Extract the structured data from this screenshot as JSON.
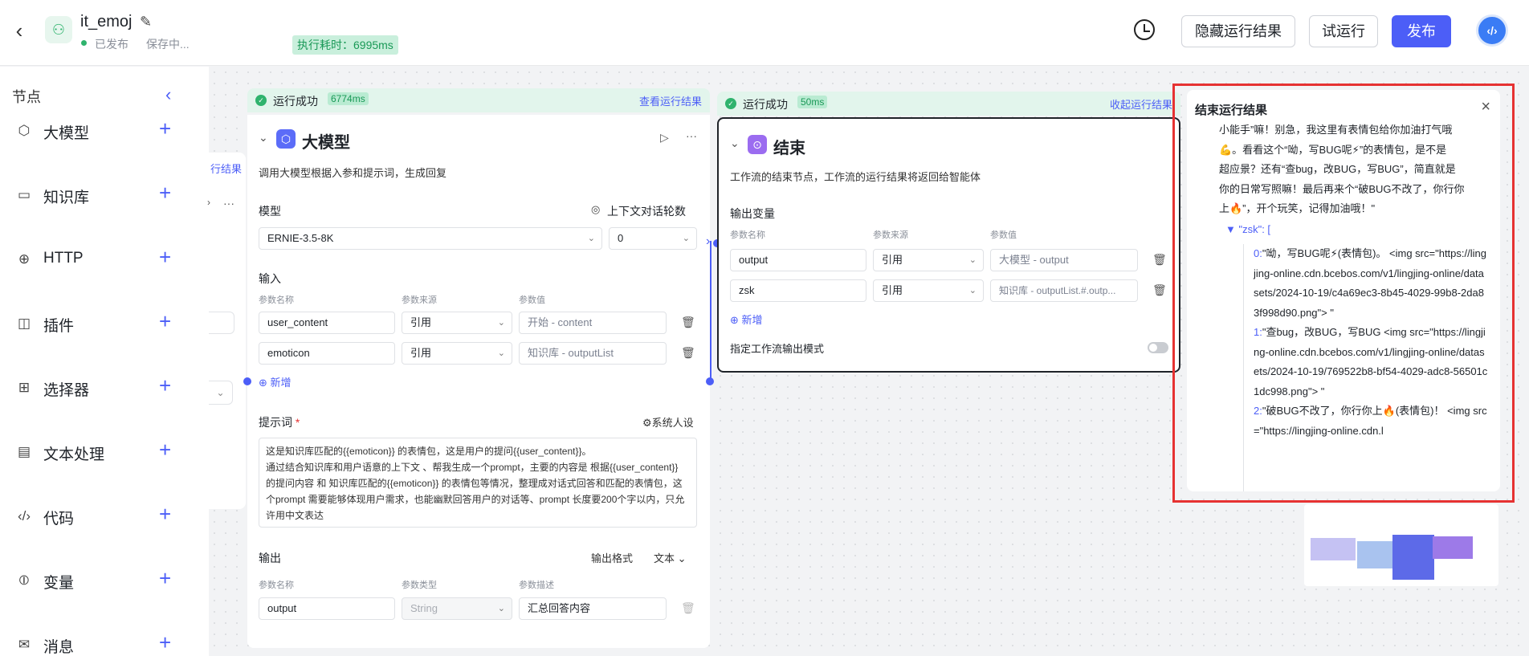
{
  "topbar": {
    "app_name": "it_emoj",
    "publish_status": "已发布",
    "saving_status": "保存中...",
    "exec_time": "执行耗时：6995ms",
    "hide_results": "隐藏运行结果",
    "trial_run": "试运行",
    "publish": "发布"
  },
  "sidebar": {
    "title": "节点",
    "items": [
      {
        "label": "大模型",
        "icon": "cube-icon"
      },
      {
        "label": "知识库",
        "icon": "monitor-icon"
      },
      {
        "label": "HTTP",
        "icon": "globe-icon"
      },
      {
        "label": "插件",
        "icon": "plugin-icon"
      },
      {
        "label": "选择器",
        "icon": "selector-icon"
      },
      {
        "label": "文本处理",
        "icon": "text-icon"
      },
      {
        "label": "代码",
        "icon": "code-icon"
      },
      {
        "label": "变量",
        "icon": "variable-icon"
      },
      {
        "label": "消息",
        "icon": "message-icon"
      }
    ]
  },
  "canvas": {
    "partial_link": "行结果"
  },
  "llm_node": {
    "status": "运行成功",
    "time": "6774ms",
    "view_link": "查看运行结果",
    "title": "大模型",
    "desc": "调用大模型根据入参和提示词，生成回复",
    "model_label": "模型",
    "context_label": "上下文对话轮数",
    "model_value": "ERNIE-3.5-8K",
    "context_value": "0",
    "input_label": "输入",
    "col_name": "参数名称",
    "col_source": "参数来源",
    "col_value": "参数值",
    "inputs": [
      {
        "name": "user_content",
        "source": "引用",
        "value": "开始 - content"
      },
      {
        "name": "emoticon",
        "source": "引用",
        "value": "知识库 - outputList"
      }
    ],
    "add": "新增",
    "prompt_label": "提示词",
    "system_persona": "系统人设",
    "prompt_text": "这是知识库匹配的{{emoticon}} 的表情包，这是用户的提问{{user_content}}。\n通过结合知识库和用户语意的上下文 、帮我生成一个prompt，主要的内容是 根据{{user_content}} 的提问内容 和 知识库匹配的{{emoticon}} 的表情包等情况，整理成对话式回答和匹配的表情包，这个prompt 需要能够体现用户需求，也能幽默回答用户的对话等、prompt 长度要200个字以内，只允许用中文表达",
    "output_label": "输出",
    "output_format_label": "输出格式",
    "output_format_value": "文本",
    "col_type": "参数类型",
    "col_desc": "参数描述",
    "output": {
      "name": "output",
      "type": "String",
      "desc": "汇总回答内容"
    }
  },
  "end_node": {
    "status": "运行成功",
    "time": "50ms",
    "collapse_link": "收起运行结果",
    "title": "结束",
    "desc": "工作流的结束节点，工作流的运行结果将返回给智能体",
    "output_vars_label": "输出变量",
    "col_name": "参数名称",
    "col_source": "参数来源",
    "col_value": "参数值",
    "outputs": [
      {
        "name": "output",
        "source": "引用",
        "value": "大模型 - output"
      },
      {
        "name": "zsk",
        "source": "引用",
        "value": "知识库 - outputList.#.outp..."
      }
    ],
    "add": "新增",
    "mode_label": "指定工作流输出模式"
  },
  "result_panel": {
    "title": "结束运行结果",
    "lines": [
      "小能手”嘛！别急，我这里有表情包给你加油打气哦",
      "💪。看看这个“呦，写BUG呢⚡”的表情包，是不是",
      "超应景？还有“查bug，改BUG，写BUG”，简直就是",
      "你的日常写照嘛！最后再来个“破BUG不改了，你行你",
      "上🔥”，开个玩笑，记得加油哦！\""
    ],
    "zsk_label": "▼ \"zsk\": [",
    "items": [
      {
        "idx": "0:",
        "text": "\"呦，写BUG呢⚡(表情包)。 <img src=\"https://lingjing-online.cdn.bcebos.com/v1/lingjing-online/datasets/2024-10-19/c4a69ec3-8b45-4029-99b8-2da83f998d90.png\"> \""
      },
      {
        "idx": "1:",
        "text": "\"查bug，改BUG，写BUG <img src=\"https://lingjing-online.cdn.bcebos.com/v1/lingjing-online/datasets/2024-10-19/769522b8-bf54-4029-adc8-56501c1dc998.png\"> \""
      },
      {
        "idx": "2:",
        "text": "\"破BUG不改了，你行你上🔥(表情包)！ <img src=\"https://lingjing-online.cdn.l"
      }
    ]
  },
  "colors": {
    "accent": "#4c5ef7",
    "success": "#2fb36d",
    "highlight_border": "#e63232"
  }
}
